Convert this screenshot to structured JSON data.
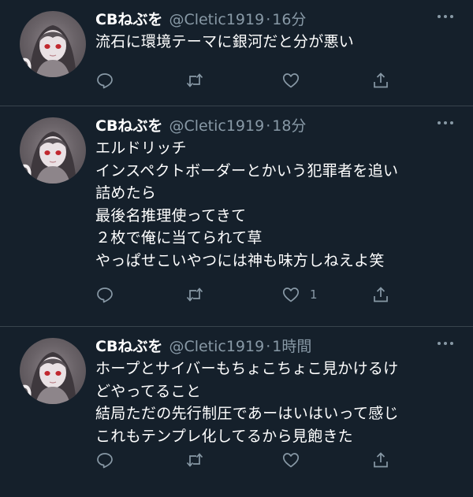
{
  "colors": {
    "background": "#15202b",
    "divider": "#38444d",
    "text": "#ffffff",
    "secondary": "#8899a6"
  },
  "icons": {
    "reply": "reply-icon",
    "retweet": "retweet-icon",
    "like": "like-icon",
    "share": "share-icon",
    "more": "more-icon"
  },
  "tweets": [
    {
      "name": "CBねぶを",
      "handle": "@Cletic1919",
      "separator": "·",
      "time": "16分",
      "text": "流石に環境テーマに銀河だと分が悪い",
      "like_count": ""
    },
    {
      "name": "CBねぶを",
      "handle": "@Cletic1919",
      "separator": "·",
      "time": "18分",
      "text": "エルドリッチ\nインスペクトボーダーとかいう犯罪者を追い\n詰めたら\n最後名推理使ってきて\n２枚で俺に当てられて草\nやっぱせこいやつには神も味方しねえよ笑",
      "like_count": "1"
    },
    {
      "name": "CBねぶを",
      "handle": "@Cletic1919",
      "separator": "·",
      "time": "1時間",
      "text": "ホープとサイバーもちょこちょこ見かけるけ\nどやってること\n結局ただの先行制圧であーはいはいって感じ\nこれもテンプレ化してるから見飽きた",
      "like_count": ""
    }
  ]
}
